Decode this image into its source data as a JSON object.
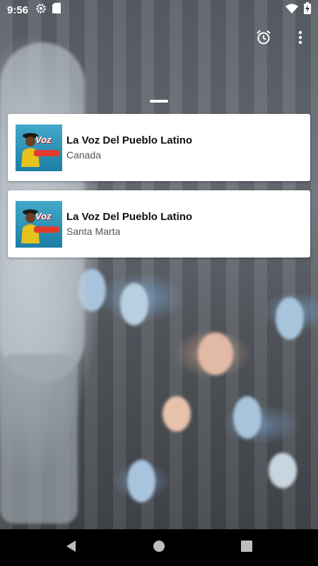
{
  "status_bar": {
    "time": "9:56",
    "left_icons": [
      "gear-icon",
      "sd-card-icon"
    ],
    "right_icons": [
      "wifi-icon",
      "battery-charging-icon"
    ]
  },
  "toolbar": {
    "icons": [
      "alarm-icon",
      "overflow-menu-icon"
    ]
  },
  "stations": [
    {
      "name": "La Voz Del Pueblo Latino",
      "subtitle": "Canada",
      "logo_text": "Voz"
    },
    {
      "name": "La Voz Del Pueblo Latino",
      "subtitle": "Santa Marta",
      "logo_text": "Voz"
    }
  ],
  "nav": {
    "icons": [
      "back-icon",
      "home-icon",
      "recents-icon"
    ]
  },
  "colors": {
    "card": "#ffffff",
    "logo_blue": "#2b91bb",
    "logo_red": "#e23b2d",
    "nav_bar": "#000000"
  }
}
